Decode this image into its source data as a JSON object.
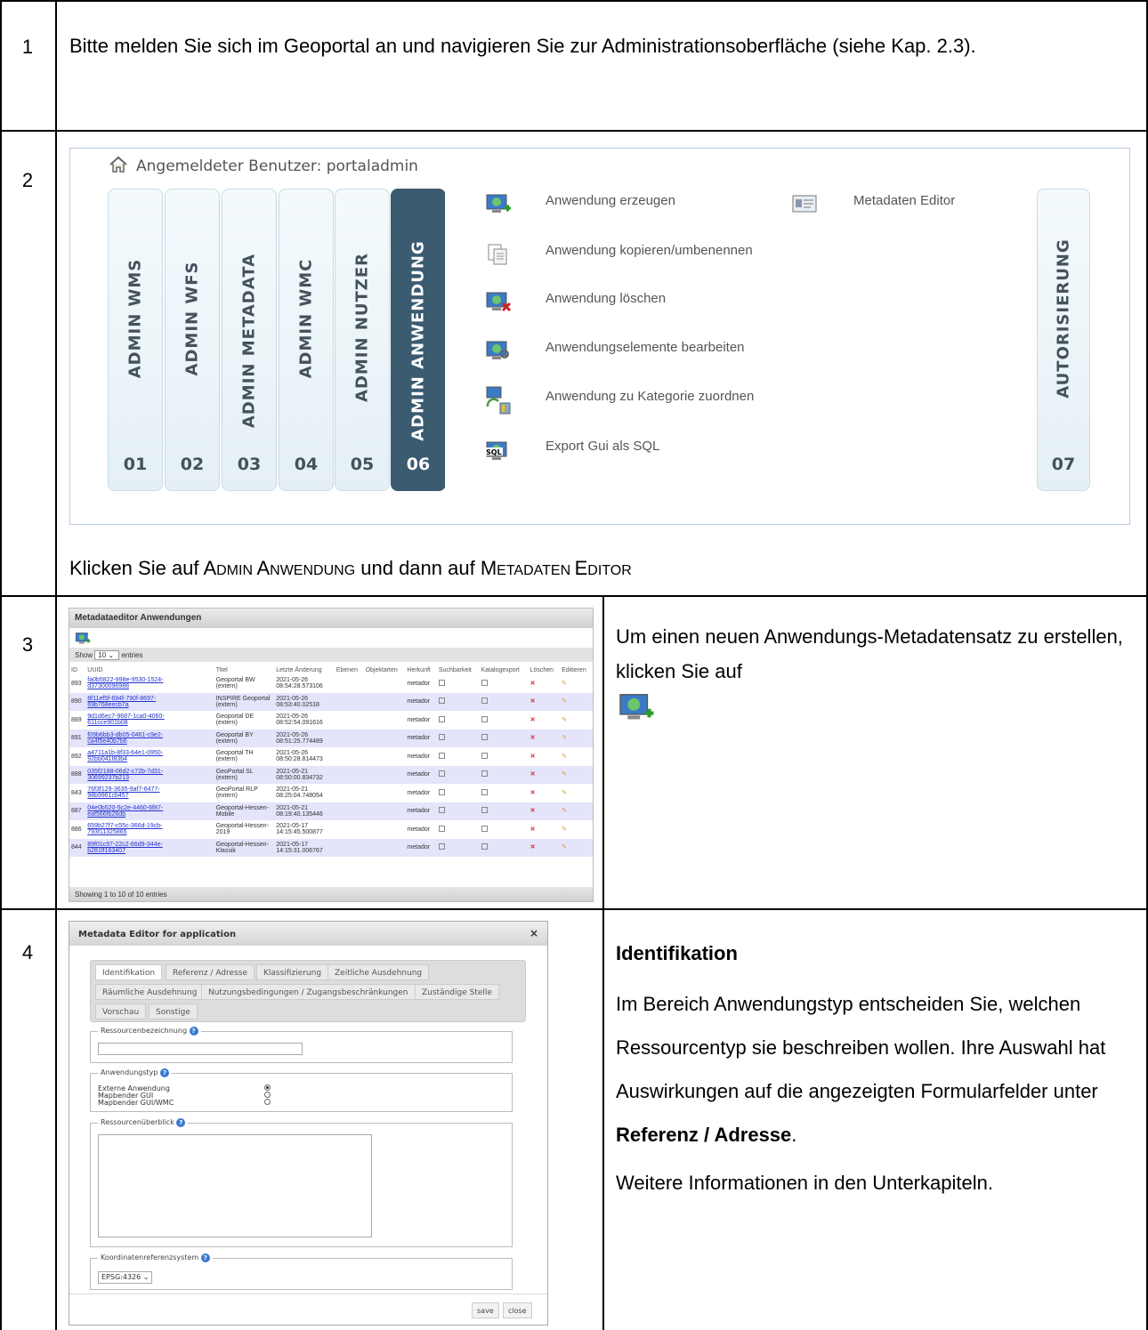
{
  "rows": [
    {
      "number": "1",
      "text": "Bitte melden Sie sich im Geoportal an und navigieren Sie zur Administrationsoberfläche (siehe Kap. 2.3)."
    },
    {
      "number": "2"
    },
    {
      "number": "3"
    },
    {
      "number": "4"
    }
  ],
  "admin_panel": {
    "user_label": "Angemeldeter Benutzer: portaladmin",
    "tabs": [
      {
        "label": "ADMIN WMS",
        "number": "01"
      },
      {
        "label": "ADMIN WFS",
        "number": "02"
      },
      {
        "label": "ADMIN METADATA",
        "number": "03"
      },
      {
        "label": "ADMIN WMC",
        "number": "04"
      },
      {
        "label": "ADMIN NUTZER",
        "number": "05"
      },
      {
        "label": "ADMIN ANWENDUNG",
        "number": "06",
        "active": true
      },
      {
        "label": "AUTORISIERUNG",
        "number": "07"
      }
    ],
    "menu_items": [
      "Anwendung erzeugen",
      "Anwendung kopieren/umbenennen",
      "Anwendung löschen",
      "Anwendungselemente bearbeiten",
      "Anwendung zu Kategorie zuordnen",
      "Export Gui als SQL"
    ],
    "metadata_editor": "Metadaten Editor"
  },
  "step2_instruction": {
    "prefix": "Klicken Sie auf ",
    "a1": "A",
    "a2": "DMIN ",
    "a3": "A",
    "a4": "NWENDUNG",
    "middle": " und dann auf ",
    "m1": "M",
    "m2": "ETADATEN ",
    "m3": "E",
    "m4": "DITOR"
  },
  "metadata_list": {
    "title": "Metadataeditor Anwendungen",
    "show_label": "Show",
    "show_value": "10",
    "entries_label": "entries",
    "columns": [
      "ID",
      "UUID",
      "Titel",
      "Letzte Änderung",
      "Ebenen",
      "Objektarten",
      "Herkunft",
      "Suchbarkeit",
      "Katalogexport",
      "Löschen",
      "Editieren"
    ],
    "rows": [
      {
        "id": "893",
        "uuid": "fa0b5822-998e-9530-1524-d37300096988",
        "title": "Geoportal BW (extern)",
        "date": "2021-05-26 08:54:28.573106",
        "origin": "metador"
      },
      {
        "id": "890",
        "uuid": "8f11ef5f-694f-790f-8697-69b768eecb7a",
        "title": "INSPIRE Geoportal (extern)",
        "date": "2021-05-26 08:53:40.02518",
        "origin": "metador"
      },
      {
        "id": "889",
        "uuid": "9d1d6ec7-9687-1ca0-4060-611cce901b08",
        "title": "Geoportal DE (extern)",
        "date": "2021-05-26 08:52:54.091616",
        "origin": "metador"
      },
      {
        "id": "891",
        "uuid": "f09b6bb3-db05-0461-c9e2-ca4f5e40b7b6",
        "title": "Geoportal BY (extern)",
        "date": "2021-05-26 08:51:25.774489",
        "origin": "metador"
      },
      {
        "id": "892",
        "uuid": "a4711a1b-8f33-64e1-0950-92bb041f83b4",
        "title": "Geoportal TH (extern)",
        "date": "2021-05-26 08:50:28.814473",
        "origin": "metador"
      },
      {
        "id": "888",
        "uuid": "035f2188-06d2-c72b-7d31-30699237b213",
        "title": "GeoPortal SL (extern)",
        "date": "2021-05-21 08:50:00.834732",
        "origin": "metador"
      },
      {
        "id": "843",
        "uuid": "76f3f129-3635-9af7-6477-98b9961cb457",
        "title": "GeoPortal RLP (extern)",
        "date": "2021-05-21 08:25:04.748054",
        "origin": "metador"
      },
      {
        "id": "887",
        "uuid": "04e0b520-5c2e-4460-6f87-eaf566fb26db",
        "title": "Geoportal-Hessen-Mobile",
        "date": "2021-05-21 08:19:40.135446",
        "origin": "metador"
      },
      {
        "id": "886",
        "uuid": "659b27f7-c55c-366d-19cb-793f11325865",
        "title": "Geoportal-Hessen-2019",
        "date": "2021-05-17 14:15:45.500877",
        "origin": "metador"
      },
      {
        "id": "844",
        "uuid": "89f01c97-22c2-66d9-344e-b281ff163407",
        "title": "Geoportal-Hessen-Klassik",
        "date": "2021-05-17 14:15:31.006767",
        "origin": "metador"
      }
    ],
    "footer": "Showing 1 to 10 of 10 entries"
  },
  "step3_text": "Um einen neuen Anwendungs-Metadatensatz zu erstellen, klicken Sie auf",
  "dialog": {
    "title": "Metadata Editor for application",
    "close": "×",
    "tabs_row1": [
      "Identifikation",
      "Referenz / Adresse",
      "Klassifizierung",
      "Zeitliche Ausdehnung"
    ],
    "tabs_row2": [
      "Räumliche Ausdehnung",
      "Nutzungsbedingungen / Zugangsbeschränkungen",
      "Zuständige Stelle"
    ],
    "tabs_row3": [
      "Vorschau",
      "Sonstige"
    ],
    "fields": {
      "ressource_label": "Ressourcenbezeichnung",
      "type_label": "Anwendungstyp",
      "types": [
        "Externe Anwendung",
        "Mapbender GUI",
        "Mapbender GUI/WMC"
      ],
      "overview_label": "Ressourcenüberblick",
      "crs_label": "Koordinatenreferenzsystem",
      "crs_value": "EPSG:4326"
    },
    "save": "save",
    "close_button": "close"
  },
  "step4": {
    "heading": "Identifikation",
    "p1": "Im Bereich Anwendungstyp entscheiden Sie, welchen Ressourcentyp sie beschreiben wollen. Ihre Auswahl hat Auswirkungen auf die angezeigten Formularfelder unter",
    "p1_bold": "Referenz / Adresse",
    "p1_end": ".",
    "p2": "Weitere Informationen in den Unterkapiteln."
  }
}
